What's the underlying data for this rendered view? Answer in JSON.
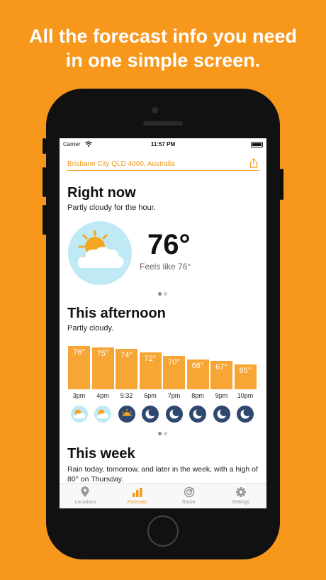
{
  "headline": {
    "line1": "All the forecast info you need",
    "line2": "in one simple screen."
  },
  "status_bar": {
    "carrier": "Carrier",
    "time": "11:57 PM"
  },
  "location": {
    "text": "Brisbane City QLD 4000, Australia"
  },
  "right_now": {
    "title": "Right now",
    "subtitle": "Partly cloudy for the hour.",
    "temperature": "76°",
    "feels_like": "Feels like 76°",
    "icon": "partly-cloudy-day-icon"
  },
  "afternoon": {
    "title": "This afternoon",
    "subtitle": "Partly cloudy."
  },
  "chart_data": {
    "type": "bar",
    "categories": [
      "3pm",
      "4pm",
      "5:32",
      "6pm",
      "7pm",
      "8pm",
      "9pm",
      "10pm"
    ],
    "values": [
      76,
      75,
      74,
      72,
      70,
      68,
      67,
      65
    ],
    "value_labels": [
      "76°",
      "75°",
      "74°",
      "72°",
      "70°",
      "68°",
      "67°",
      "65°"
    ],
    "icons": [
      "partly-cloudy-day-icon",
      "partly-cloudy-day-icon",
      "sunset-icon",
      "moon-icon",
      "moon-icon",
      "moon-icon",
      "moon-icon",
      "moon-icon"
    ],
    "ylim": [
      50,
      78
    ],
    "bar_color": "#F7A534"
  },
  "this_week": {
    "title": "This week",
    "summary": "Rain today, tomorrow, and later in the week, with a high of 80° on Thursday."
  },
  "tabs": [
    {
      "label": "Locations",
      "icon": "location-pin-icon",
      "active": false
    },
    {
      "label": "Forecast",
      "icon": "bar-chart-icon",
      "active": true
    },
    {
      "label": "Radar",
      "icon": "radar-icon",
      "active": false
    },
    {
      "label": "Settings",
      "icon": "gear-icon",
      "active": false
    }
  ],
  "colors": {
    "background": "#F7981D",
    "accent": "#F29A1A",
    "day_icon": "#BFE9F5",
    "night_icon": "#2F4870"
  }
}
